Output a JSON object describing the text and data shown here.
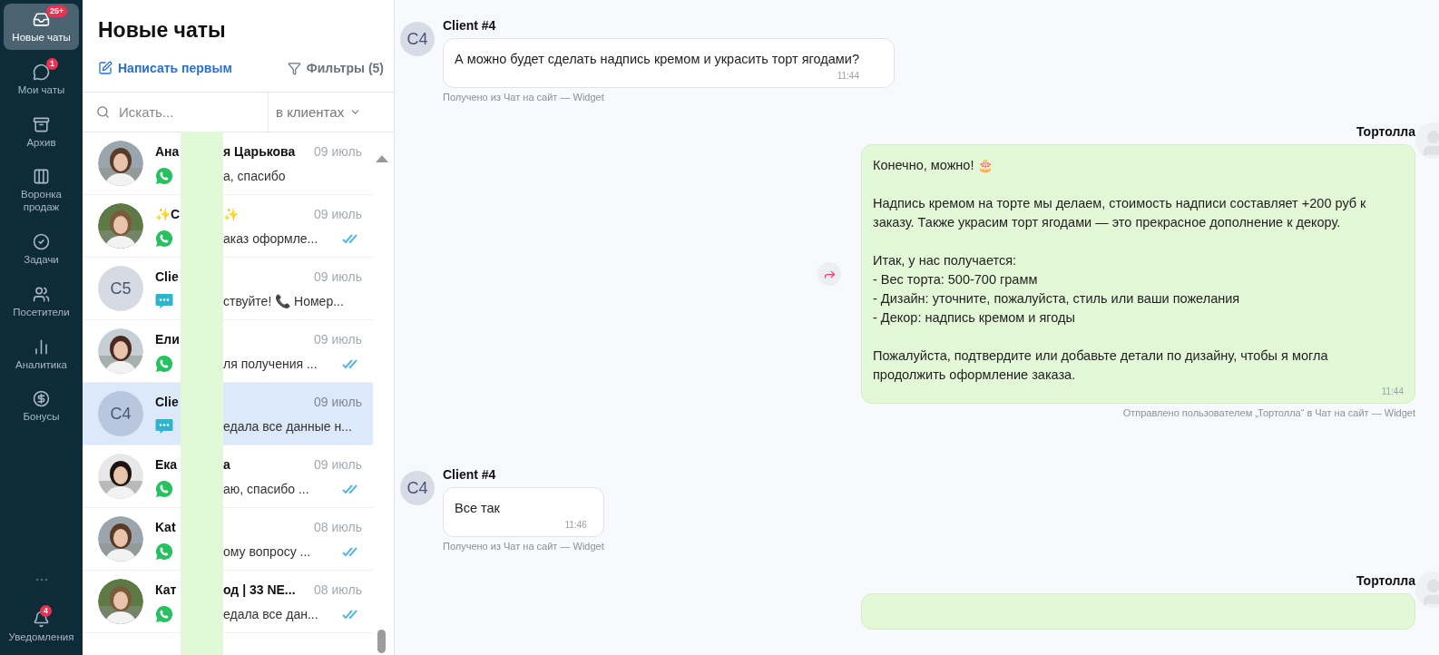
{
  "sidebar": {
    "items": [
      {
        "label": "Новые чаты",
        "selected": true,
        "badge": "25+"
      },
      {
        "label": "Мои чаты",
        "selected": false,
        "badge": "1"
      },
      {
        "label": "Архив",
        "selected": false
      },
      {
        "label": "Воронка продаж",
        "selected": false
      },
      {
        "label": "Задачи",
        "selected": false
      },
      {
        "label": "Посетители",
        "selected": false
      },
      {
        "label": "Аналитика",
        "selected": false
      },
      {
        "label": "Бонусы",
        "selected": false
      }
    ],
    "bottom": {
      "label": "Уведомления",
      "badge": "4"
    }
  },
  "chat_list": {
    "title": "Новые чаты",
    "write_first": "Написать первым",
    "filters": "Фильтры (5)",
    "search": {
      "placeholder": "Искать...",
      "scope": "в клиентах"
    },
    "rows": [
      {
        "name_start": "Ана",
        "name_end": "я Царькова",
        "preview": "а, спасибо",
        "date": "09 июль",
        "kind": "whatsapp",
        "read": false,
        "selected": false
      },
      {
        "name_start": "✨С",
        "name_end": "✨",
        "preview": "аказ оформле...",
        "date": "09 июль",
        "kind": "whatsapp",
        "read": true,
        "selected": false
      },
      {
        "name_start": "Clie",
        "preview": "ствуйте! 📞 Номер...",
        "date": "09 июль",
        "kind": "chat",
        "initials": "C5",
        "read": false,
        "selected": false
      },
      {
        "name_start": "Ели",
        "preview": "ля получения ...",
        "date": "09 июль",
        "kind": "whatsapp",
        "read": true,
        "selected": false
      },
      {
        "name_start": "Clie",
        "preview": "едала все данные н...",
        "date": "09 июль",
        "kind": "chat",
        "initials": "C4",
        "read": false,
        "selected": true
      },
      {
        "name_start": "Ека",
        "name_end": "а",
        "preview": "аю, спасибо ...",
        "date": "09 июль",
        "kind": "whatsapp",
        "read": true,
        "selected": false
      },
      {
        "name_start": "Kat",
        "preview": "ому вопросу ...",
        "date": "08 июль",
        "kind": "whatsapp",
        "read": true,
        "selected": false
      },
      {
        "name_start": "Кат",
        "name_end": "од | 33 NE...",
        "preview": "едала все дан...",
        "date": "08 июль",
        "kind": "whatsapp",
        "read": true,
        "selected": false
      }
    ]
  },
  "thread": {
    "messages": [
      {
        "kind": "incoming",
        "initials": "C4",
        "author": "Client #4",
        "text": "А можно будет сделать надпись кремом и украсить торт ягодами?",
        "time": "11:44",
        "footer": "Получено из Чат на сайт — Widget"
      },
      {
        "kind": "outgoing",
        "author": "Тортолла",
        "text": "Конечно, можно! 🎂\n\nНадпись кремом на торте мы делаем, стоимость надписи составляет +200 руб к заказу. Также украсим торт ягодами — это прекрасное дополнение к декору.\n\nИтак, у нас получается:\n- Вес торта: 500-700 грамм\n- Дизайн: уточните, пожалуйста, стиль или ваши пожелания\n- Декор: надпись кремом и ягоды\n\nПожалуйста, подтвердите или добавьте детали по дизайну, чтобы я могла продолжить оформление заказа.",
        "time": "11:44",
        "footer": "Отправлено пользователем „Тортолла“ в Чат на сайт — Widget"
      },
      {
        "kind": "incoming",
        "initials": "C4",
        "author": "Client #4",
        "text": "Все так",
        "time": "11:46",
        "footer": "Получено из Чат на сайт — Widget"
      },
      {
        "kind": "outgoing",
        "author": "Тортолла"
      }
    ]
  }
}
